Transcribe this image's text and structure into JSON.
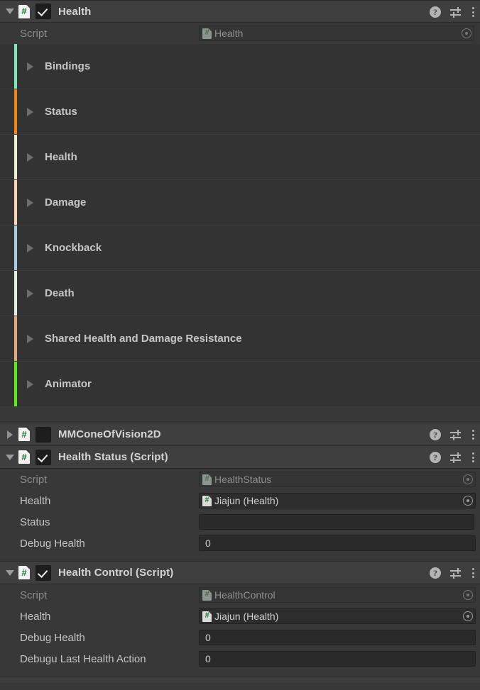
{
  "health_component": {
    "title": "Health",
    "enabled": true,
    "expanded": true,
    "script_row": {
      "label": "Script",
      "value": "Health"
    },
    "groups": [
      {
        "label": "Bindings",
        "color": "#7fe9bd"
      },
      {
        "label": "Status",
        "color": "#f58613"
      },
      {
        "label": "Health",
        "color": "#f0eed7"
      },
      {
        "label": "Damage",
        "color": "#fbd4b4"
      },
      {
        "label": "Knockback",
        "color": "#a8cfe4"
      },
      {
        "label": "Death",
        "color": "#e3efe0"
      },
      {
        "label": "Shared Health and Damage Resistance",
        "color": "#e0ab7e"
      },
      {
        "label": "Animator",
        "color": "#5bf010"
      }
    ]
  },
  "cone_component": {
    "title": "MMConeOfVision2D",
    "enabled": false,
    "expanded": false
  },
  "health_status_component": {
    "title": "Health Status (Script)",
    "enabled": true,
    "expanded": true,
    "rows": [
      {
        "label": "Script",
        "value": "HealthStatus",
        "type": "object",
        "dim": true
      },
      {
        "label": "Health",
        "value": "Jiajun (Health)",
        "type": "object",
        "dim": false
      },
      {
        "label": "Status",
        "value": "",
        "type": "text",
        "dim": false
      },
      {
        "label": "Debug Health",
        "value": "0",
        "type": "text",
        "dim": false
      }
    ]
  },
  "health_control_component": {
    "title": "Health Control (Script)",
    "enabled": true,
    "expanded": true,
    "rows": [
      {
        "label": "Script",
        "value": "HealthControl",
        "type": "object",
        "dim": true
      },
      {
        "label": "Health",
        "value": "Jiajun (Health)",
        "type": "object",
        "dim": false
      },
      {
        "label": "Debug Health",
        "value": "0",
        "type": "text",
        "dim": false
      },
      {
        "label": "Debugu Last Health Action",
        "value": "0",
        "type": "text",
        "dim": false
      }
    ]
  },
  "icons": {
    "help": "?",
    "hash": "#",
    "preset": "preset-icon",
    "kebab": "more-menu-icon",
    "object_picker": "object-picker-icon"
  },
  "theme": {
    "background": "#383838",
    "header_background": "#3f3f3f",
    "group_background": "#333333",
    "field_background": "#2a2a2a",
    "text": "#d2d2d2",
    "script_green": "#1d7a3c"
  }
}
